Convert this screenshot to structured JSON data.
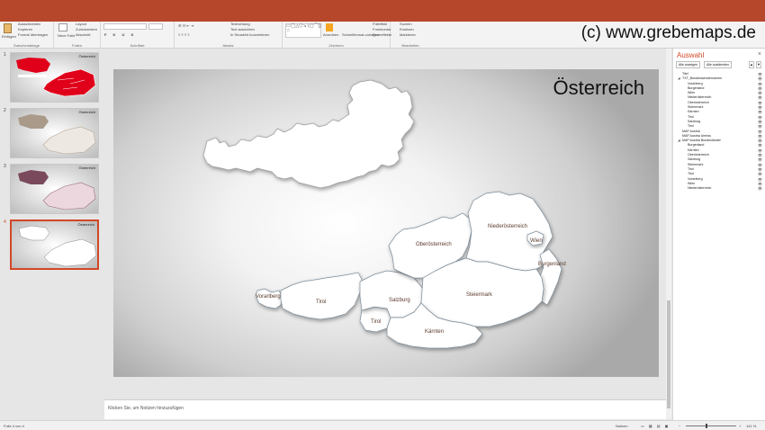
{
  "watermark": "(c) www.grebemaps.de",
  "ribbon": {
    "paste": "Einfügen",
    "cut": "Ausschneiden",
    "copy": "Kopieren",
    "format_painter": "Format übertragen",
    "clipboard_group": "Zwischenablage",
    "new_slide": "Neue Folie",
    "layout": "Layout",
    "reset": "Zurücksetzen",
    "section": "Abschnitt",
    "slides_group": "Folien",
    "font_group": "Schriftart",
    "paragraph_group": "Absatz",
    "text_direction": "Textrichtung",
    "align_text": "Text ausrichten",
    "smartart": "In SmartArt konvertieren",
    "arrange": "Anordnen",
    "quick_styles": "Schnellformat-vorlagen",
    "drawing_group": "Zeichnen",
    "shape_fill": "Fülleffekt",
    "shape_outline": "Formkontur",
    "shape_effects": "Formeffekte",
    "find": "Suchen",
    "replace": "Ersetzen",
    "select": "Markieren",
    "editing_group": "Bearbeiten"
  },
  "thumbnails": [
    {
      "num": "1",
      "label": "Österreich"
    },
    {
      "num": "2",
      "label": "Österreich"
    },
    {
      "num": "3",
      "label": "Österreich"
    },
    {
      "num": "4",
      "label": "Österreich"
    }
  ],
  "slide": {
    "title": "Österreich",
    "states": {
      "vorarlberg": "Vorarlberg",
      "tirol": "Tirol",
      "tirol_east": "Tirol",
      "salzburg": "Salzburg",
      "oberoesterreich": "Oberösterreich",
      "niederoesterreich": "Niederösterreich",
      "wien": "Wien",
      "burgenland": "Burgenland",
      "steiermark": "Steiermark",
      "kaernten": "Kärnten"
    }
  },
  "notes": "Klicken Sie, um Notizen hinzuzufügen",
  "selection_pane": {
    "title": "Auswahl",
    "close": "×",
    "show_all": "Alle anzeigen",
    "hide_all": "Alle ausblenden",
    "items": [
      {
        "label": "Titel",
        "level": 0,
        "caret": ""
      },
      {
        "label": "TXT_Bundeslaendernamen",
        "level": 0,
        "caret": "◢"
      },
      {
        "label": "Vorarlberg",
        "level": 1,
        "caret": ""
      },
      {
        "label": "Burgenland",
        "level": 1,
        "caret": ""
      },
      {
        "label": "Wien",
        "level": 1,
        "caret": ""
      },
      {
        "label": "Niederösterreich",
        "level": 1,
        "caret": ""
      },
      {
        "label": "Oberösterreich",
        "level": 1,
        "caret": ""
      },
      {
        "label": "Steiermark",
        "level": 1,
        "caret": ""
      },
      {
        "label": "Kärnten",
        "level": 1,
        "caret": ""
      },
      {
        "label": "Tirol",
        "level": 1,
        "caret": ""
      },
      {
        "label": "Salzburg",
        "level": 1,
        "caret": ""
      },
      {
        "label": "Tirol",
        "level": 1,
        "caret": ""
      },
      {
        "label": "MAP Austria",
        "level": 0,
        "caret": ""
      },
      {
        "label": "MAP Austria Umriss",
        "level": 0,
        "caret": ""
      },
      {
        "label": "MAP Austria Bundesländer",
        "level": 0,
        "caret": "◢"
      },
      {
        "label": "Burgenland",
        "level": 1,
        "caret": ""
      },
      {
        "label": "Kärnten",
        "level": 1,
        "caret": ""
      },
      {
        "label": "Oberösterreich",
        "level": 1,
        "caret": ""
      },
      {
        "label": "Salzburg",
        "level": 1,
        "caret": ""
      },
      {
        "label": "Steiermark",
        "level": 1,
        "caret": ""
      },
      {
        "label": "Tirol",
        "level": 1,
        "caret": ""
      },
      {
        "label": "Tirol",
        "level": 1,
        "caret": ""
      },
      {
        "label": "Vorarlberg",
        "level": 1,
        "caret": ""
      },
      {
        "label": "Wien",
        "level": 1,
        "caret": ""
      },
      {
        "label": "Niederösterreich",
        "level": 1,
        "caret": ""
      }
    ]
  },
  "status": {
    "slide_info": "Folie 4 von 4",
    "notes_label": "Notizen",
    "zoom": "141 %"
  },
  "colors": {
    "brand": "#b7472a",
    "accent": "#d24726",
    "map_fill": "#ffffff",
    "map_stroke": "#7d8c99",
    "label_text": "#5a3a2a"
  }
}
